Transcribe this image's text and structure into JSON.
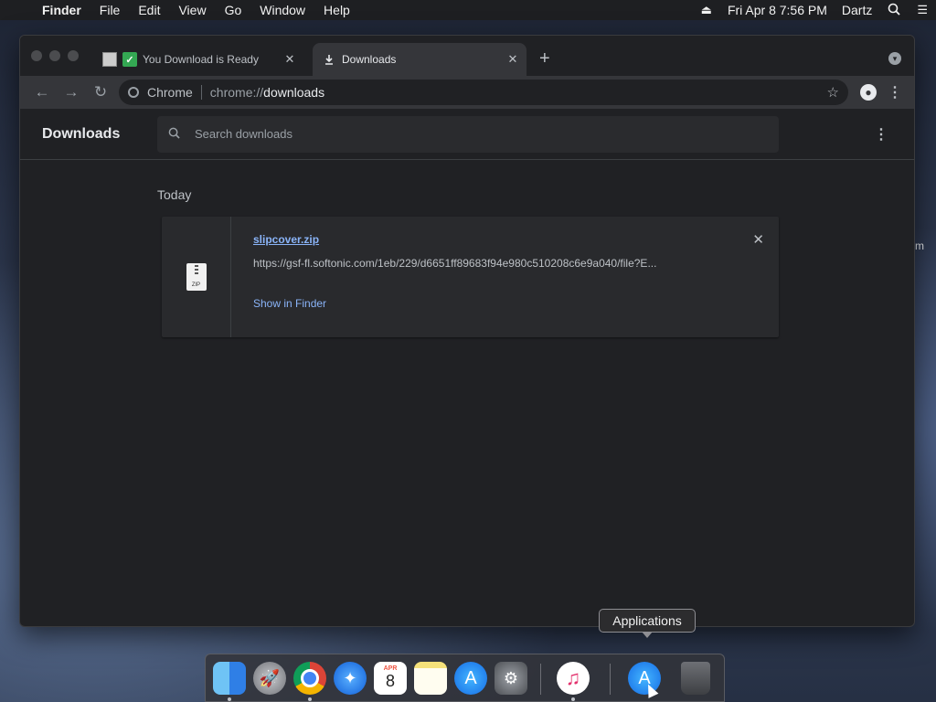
{
  "menubar": {
    "app_name": "Finder",
    "menus": [
      "File",
      "Edit",
      "View",
      "Go",
      "Window",
      "Help"
    ],
    "datetime": "Fri Apr 8  7:56 PM",
    "user": "Dartz"
  },
  "browser": {
    "tabs": [
      {
        "title": "You Download is Ready",
        "favicon": "check-icon"
      },
      {
        "title": "Downloads",
        "favicon": "download-icon"
      }
    ],
    "omnibox": {
      "security_label": "Chrome",
      "url_scheme_host": "chrome://",
      "url_path": "downloads"
    }
  },
  "downloads": {
    "title": "Downloads",
    "search_placeholder": "Search downloads",
    "section_label": "Today",
    "items": [
      {
        "filename": "slipcover.zip",
        "url": "https://gsf-fl.softonic.com/1eb/229/d6651ff89683f94e980c510208c6e9a040/file?E...",
        "file_type_label": "ZIP",
        "action": "Show in Finder"
      }
    ]
  },
  "tooltip": {
    "text": "Applications"
  },
  "edge_text": "m",
  "colors": {
    "link": "#8ab4f8",
    "window_bg": "#202124",
    "toolbar_bg": "#35363a"
  }
}
